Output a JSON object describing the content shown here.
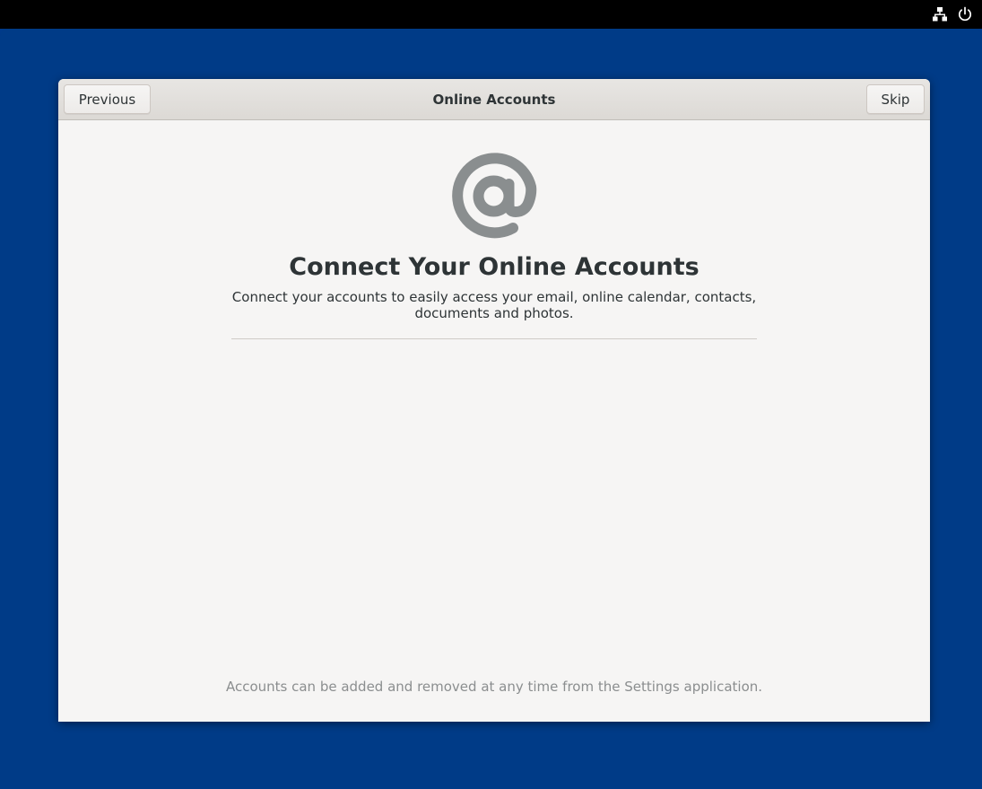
{
  "system_tray": {
    "network_icon": "network-wired-icon",
    "power_icon": "power-icon"
  },
  "window": {
    "title": "Online Accounts",
    "previous_label": "Previous",
    "skip_label": "Skip"
  },
  "page": {
    "icon": "at-sign-icon",
    "heading": "Connect Your Online Accounts",
    "description": "Connect your accounts to easily access your email, online calendar, contacts, documents and photos.",
    "footer_note": "Accounts can be added and removed at any time from the Settings application."
  },
  "colors": {
    "desktop_background": "#003b87",
    "window_background": "#f6f5f4",
    "icon_gray": "#8a8e8f",
    "text_dark": "#2e3436"
  }
}
